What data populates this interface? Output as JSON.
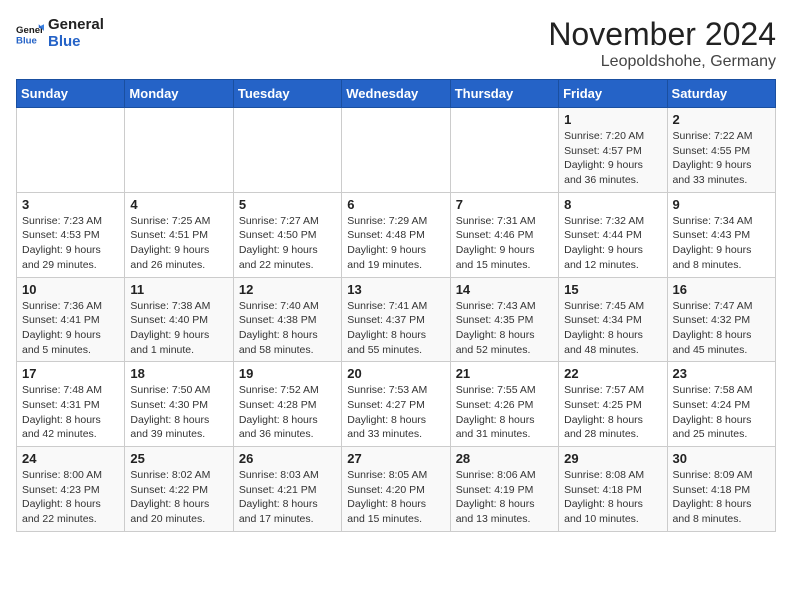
{
  "logo": {
    "line1": "General",
    "line2": "Blue"
  },
  "header": {
    "month": "November 2024",
    "location": "Leopoldshohe, Germany"
  },
  "weekdays": [
    "Sunday",
    "Monday",
    "Tuesday",
    "Wednesday",
    "Thursday",
    "Friday",
    "Saturday"
  ],
  "weeks": [
    [
      {
        "day": "",
        "info": ""
      },
      {
        "day": "",
        "info": ""
      },
      {
        "day": "",
        "info": ""
      },
      {
        "day": "",
        "info": ""
      },
      {
        "day": "",
        "info": ""
      },
      {
        "day": "1",
        "info": "Sunrise: 7:20 AM\nSunset: 4:57 PM\nDaylight: 9 hours\nand 36 minutes."
      },
      {
        "day": "2",
        "info": "Sunrise: 7:22 AM\nSunset: 4:55 PM\nDaylight: 9 hours\nand 33 minutes."
      }
    ],
    [
      {
        "day": "3",
        "info": "Sunrise: 7:23 AM\nSunset: 4:53 PM\nDaylight: 9 hours\nand 29 minutes."
      },
      {
        "day": "4",
        "info": "Sunrise: 7:25 AM\nSunset: 4:51 PM\nDaylight: 9 hours\nand 26 minutes."
      },
      {
        "day": "5",
        "info": "Sunrise: 7:27 AM\nSunset: 4:50 PM\nDaylight: 9 hours\nand 22 minutes."
      },
      {
        "day": "6",
        "info": "Sunrise: 7:29 AM\nSunset: 4:48 PM\nDaylight: 9 hours\nand 19 minutes."
      },
      {
        "day": "7",
        "info": "Sunrise: 7:31 AM\nSunset: 4:46 PM\nDaylight: 9 hours\nand 15 minutes."
      },
      {
        "day": "8",
        "info": "Sunrise: 7:32 AM\nSunset: 4:44 PM\nDaylight: 9 hours\nand 12 minutes."
      },
      {
        "day": "9",
        "info": "Sunrise: 7:34 AM\nSunset: 4:43 PM\nDaylight: 9 hours\nand 8 minutes."
      }
    ],
    [
      {
        "day": "10",
        "info": "Sunrise: 7:36 AM\nSunset: 4:41 PM\nDaylight: 9 hours\nand 5 minutes."
      },
      {
        "day": "11",
        "info": "Sunrise: 7:38 AM\nSunset: 4:40 PM\nDaylight: 9 hours\nand 1 minute."
      },
      {
        "day": "12",
        "info": "Sunrise: 7:40 AM\nSunset: 4:38 PM\nDaylight: 8 hours\nand 58 minutes."
      },
      {
        "day": "13",
        "info": "Sunrise: 7:41 AM\nSunset: 4:37 PM\nDaylight: 8 hours\nand 55 minutes."
      },
      {
        "day": "14",
        "info": "Sunrise: 7:43 AM\nSunset: 4:35 PM\nDaylight: 8 hours\nand 52 minutes."
      },
      {
        "day": "15",
        "info": "Sunrise: 7:45 AM\nSunset: 4:34 PM\nDaylight: 8 hours\nand 48 minutes."
      },
      {
        "day": "16",
        "info": "Sunrise: 7:47 AM\nSunset: 4:32 PM\nDaylight: 8 hours\nand 45 minutes."
      }
    ],
    [
      {
        "day": "17",
        "info": "Sunrise: 7:48 AM\nSunset: 4:31 PM\nDaylight: 8 hours\nand 42 minutes."
      },
      {
        "day": "18",
        "info": "Sunrise: 7:50 AM\nSunset: 4:30 PM\nDaylight: 8 hours\nand 39 minutes."
      },
      {
        "day": "19",
        "info": "Sunrise: 7:52 AM\nSunset: 4:28 PM\nDaylight: 8 hours\nand 36 minutes."
      },
      {
        "day": "20",
        "info": "Sunrise: 7:53 AM\nSunset: 4:27 PM\nDaylight: 8 hours\nand 33 minutes."
      },
      {
        "day": "21",
        "info": "Sunrise: 7:55 AM\nSunset: 4:26 PM\nDaylight: 8 hours\nand 31 minutes."
      },
      {
        "day": "22",
        "info": "Sunrise: 7:57 AM\nSunset: 4:25 PM\nDaylight: 8 hours\nand 28 minutes."
      },
      {
        "day": "23",
        "info": "Sunrise: 7:58 AM\nSunset: 4:24 PM\nDaylight: 8 hours\nand 25 minutes."
      }
    ],
    [
      {
        "day": "24",
        "info": "Sunrise: 8:00 AM\nSunset: 4:23 PM\nDaylight: 8 hours\nand 22 minutes."
      },
      {
        "day": "25",
        "info": "Sunrise: 8:02 AM\nSunset: 4:22 PM\nDaylight: 8 hours\nand 20 minutes."
      },
      {
        "day": "26",
        "info": "Sunrise: 8:03 AM\nSunset: 4:21 PM\nDaylight: 8 hours\nand 17 minutes."
      },
      {
        "day": "27",
        "info": "Sunrise: 8:05 AM\nSunset: 4:20 PM\nDaylight: 8 hours\nand 15 minutes."
      },
      {
        "day": "28",
        "info": "Sunrise: 8:06 AM\nSunset: 4:19 PM\nDaylight: 8 hours\nand 13 minutes."
      },
      {
        "day": "29",
        "info": "Sunrise: 8:08 AM\nSunset: 4:18 PM\nDaylight: 8 hours\nand 10 minutes."
      },
      {
        "day": "30",
        "info": "Sunrise: 8:09 AM\nSunset: 4:18 PM\nDaylight: 8 hours\nand 8 minutes."
      }
    ]
  ]
}
